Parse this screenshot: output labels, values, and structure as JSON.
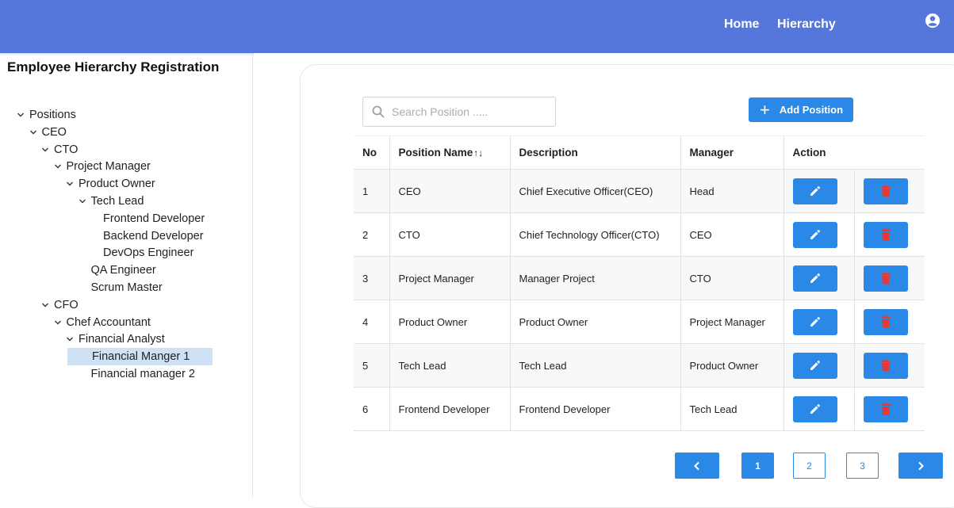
{
  "header": {
    "nav": [
      "Home",
      "Hierarchy"
    ],
    "user_icon": "user-circle-icon",
    "color": "#5577db"
  },
  "sidebar": {
    "title": "Employee Hierarchy Registration",
    "tree": [
      {
        "label": "Positions",
        "level": 0,
        "expanded": true
      },
      {
        "label": "CEO",
        "level": 1,
        "expanded": true
      },
      {
        "label": "CTO",
        "level": 2,
        "expanded": true
      },
      {
        "label": "Project Manager",
        "level": 3,
        "expanded": true
      },
      {
        "label": "Product Owner",
        "level": 4,
        "expanded": true
      },
      {
        "label": "Tech Lead",
        "level": 5,
        "expanded": true
      },
      {
        "label": "Frontend Developer",
        "level": 6
      },
      {
        "label": "Backend Developer",
        "level": 6
      },
      {
        "label": "DevOps Engineer",
        "level": 6
      },
      {
        "label": "QA Engineer",
        "level": 5
      },
      {
        "label": "Scrum Master",
        "level": 5
      },
      {
        "label": "CFO",
        "level": 2,
        "expanded": true
      },
      {
        "label": "Chef Accountant",
        "level": 3,
        "expanded": true
      },
      {
        "label": "Financial Analyst",
        "level": 4,
        "expanded": true
      },
      {
        "label": "Financial Manger 1",
        "level": 5,
        "selected": true
      },
      {
        "label": "Financial manager 2",
        "level": 5
      }
    ]
  },
  "search": {
    "placeholder": "Search Position ....."
  },
  "add_button": {
    "label": "Add Position"
  },
  "table": {
    "headers": [
      "No",
      "Position Name",
      "Description",
      "Manager",
      "Action"
    ],
    "sort_arrows": "↑↓",
    "rows": [
      {
        "no": "1",
        "name": "CEO",
        "description": "Chief Executive Officer(CEO)",
        "manager": "Head"
      },
      {
        "no": "2",
        "name": "CTO",
        "description": "Chief Technology Officer(CTO)",
        "manager": "CEO"
      },
      {
        "no": "3",
        "name": "Project Manager",
        "description": "Manager Project",
        "manager": "CTO"
      },
      {
        "no": "4",
        "name": "Product Owner",
        "description": "Product Owner",
        "manager": "Project Manager"
      },
      {
        "no": "5",
        "name": "Tech Lead",
        "description": "Tech Lead",
        "manager": "Product Owner"
      },
      {
        "no": "6",
        "name": "Frontend Developer",
        "description": "Frontend Developer",
        "manager": "Tech Lead"
      }
    ],
    "edit_icon": "pencil-icon",
    "delete_icon": "trash-icon",
    "delete_color": "#e53935"
  },
  "pagination": {
    "pages": [
      "1",
      "2",
      "3"
    ],
    "current": "1"
  }
}
